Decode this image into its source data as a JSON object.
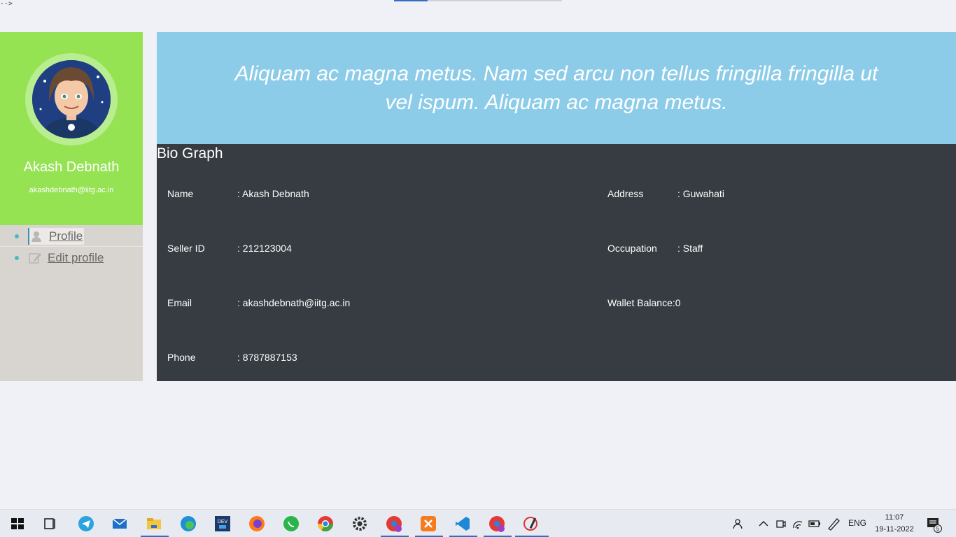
{
  "corner_text": "-->",
  "user": {
    "name": "Akash Debnath",
    "email": "akashdebnath@iitg.ac.in"
  },
  "nav": {
    "items": [
      {
        "label": "Profile",
        "icon": "user-icon",
        "active": true
      },
      {
        "label": "Edit profile",
        "icon": "edit-icon",
        "active": false
      }
    ]
  },
  "hero": {
    "text": "Aliquam ac magna metus. Nam sed arcu non tellus fringilla fringilla ut vel ispum. Aliquam ac magna metus."
  },
  "bio": {
    "title": "Bio Graph",
    "fields": {
      "name_label": "Name",
      "name_value": ": Akash Debnath",
      "seller_label": "Seller ID",
      "seller_value": ": 212123004",
      "email_label": "Email",
      "email_value": ": akashdebnath@iitg.ac.in",
      "phone_label": "Phone",
      "phone_value": ": 8787887153",
      "address_label": "Address",
      "address_value": ": Guwahati",
      "occupation_label": "Occupation",
      "occupation_value": ": Staff",
      "wallet_label": "Wallet Balance",
      "wallet_value": ":0"
    }
  },
  "colors": {
    "profile_panel": "#95e253",
    "hero": "#8dcce9",
    "bio": "#373c42",
    "sidebar": "#d8d4cf"
  },
  "taskbar": {
    "apps": [
      "windows-start-icon",
      "task-view-icon",
      "telegram-icon",
      "mail-icon",
      "file-explorer-icon",
      "edge-icon",
      "dev-icon",
      "firefox-icon",
      "whatsapp-icon",
      "chrome-icon",
      "settings-icon",
      "chrome-profile-icon",
      "xampp-icon",
      "vscode-icon",
      "chrome-profile-2-icon",
      "paint-icon"
    ],
    "language": "ENG",
    "time": "11:07",
    "date": "19-11-2022",
    "notification_count": "5"
  }
}
